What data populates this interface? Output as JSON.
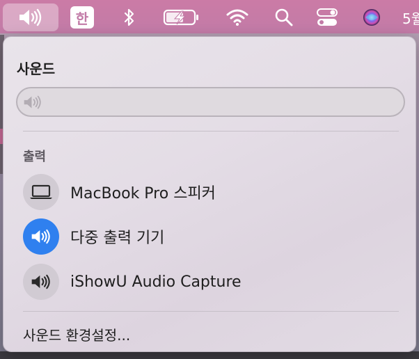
{
  "menubar": {
    "ime_label": "한",
    "date_partial": "5월",
    "accent_color": "#c27ba7",
    "icons": [
      "speaker-icon",
      "input-source",
      "bluetooth-icon",
      "battery-charging-icon",
      "wifi-icon",
      "search-icon",
      "control-center-icon",
      "siri-icon"
    ]
  },
  "panel": {
    "title": "사운드",
    "volume_percent": 0,
    "output_label": "출력",
    "devices": [
      {
        "label": "MacBook Pro 스피커",
        "icon": "laptop-icon",
        "selected": false
      },
      {
        "label": "다중 출력 기기",
        "icon": "speaker-icon",
        "selected": true
      },
      {
        "label": "iShowU Audio Capture",
        "icon": "speaker-icon",
        "selected": false
      }
    ],
    "preferences_label": "사운드 환경설정...",
    "selected_color": "#2f80ef"
  }
}
